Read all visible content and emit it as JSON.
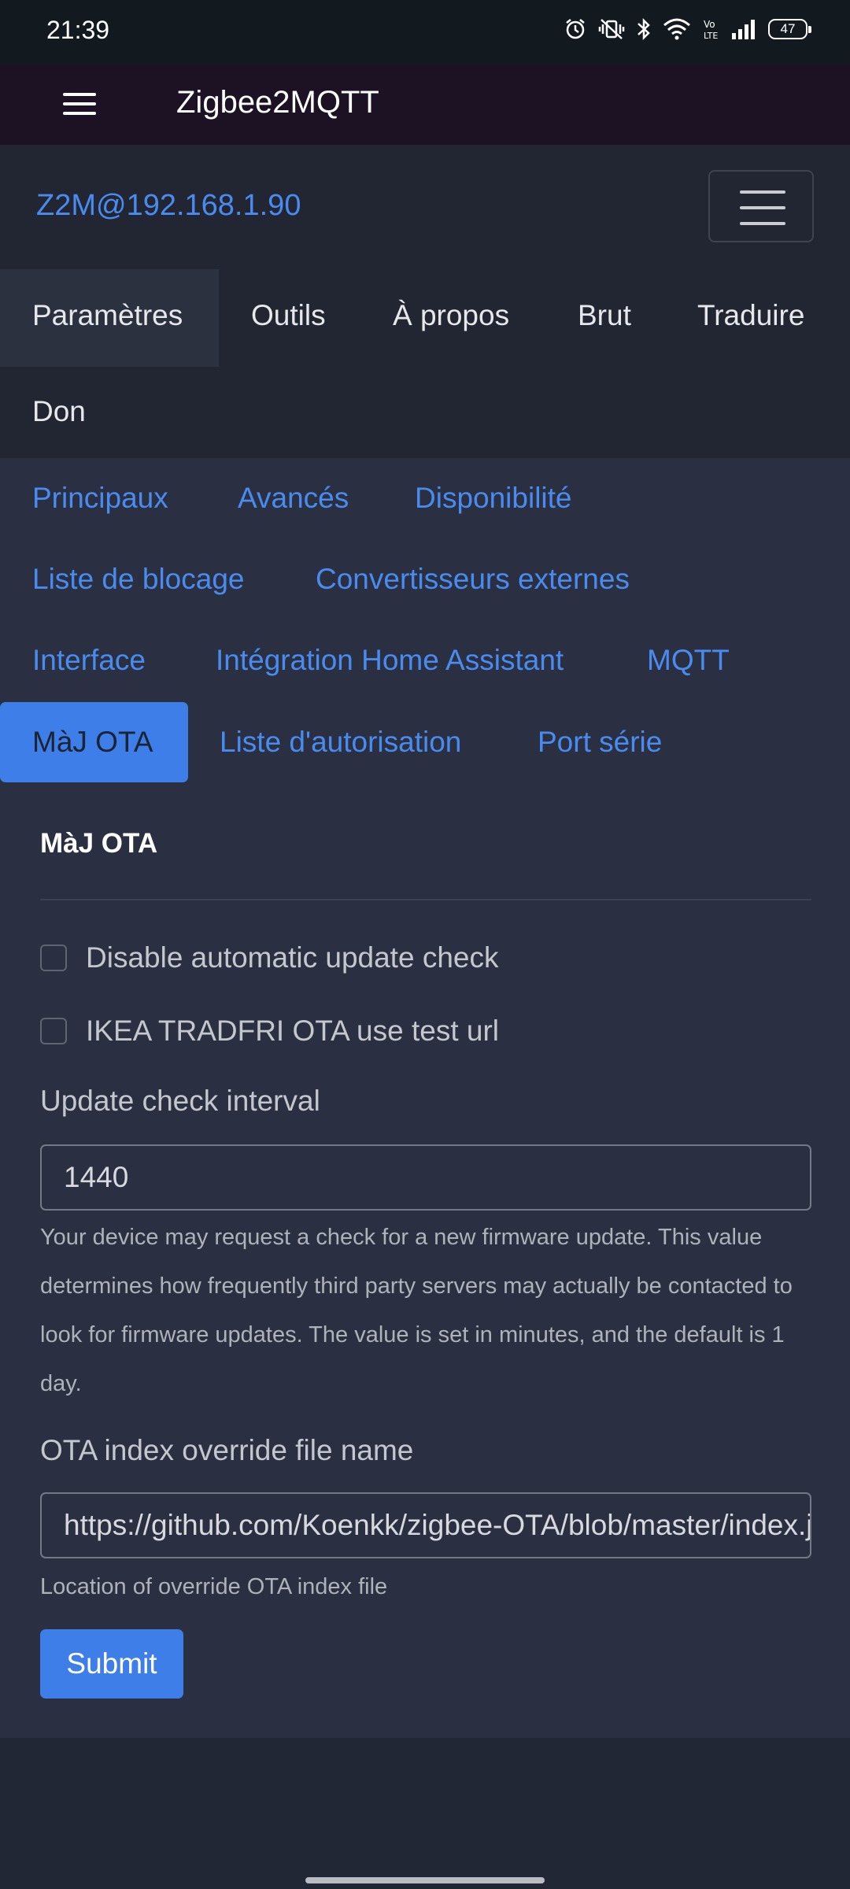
{
  "status_bar": {
    "time": "21:39",
    "battery": "47",
    "icons": [
      "alarm-icon",
      "vibrate-icon",
      "bluetooth-icon",
      "wifi-icon",
      "volte-icon",
      "signal-icon",
      "battery-icon"
    ]
  },
  "app_bar": {
    "title": "Zigbee2MQTT",
    "menu_icon": "hamburger-icon"
  },
  "top_nav": {
    "brand": "Z2M@192.168.1.90",
    "tabs": [
      "Paramètres",
      "Outils",
      "À propos",
      "Brut",
      "Traduire",
      "Don"
    ],
    "active_tab": "Paramètres"
  },
  "settings_tabs": {
    "items": [
      "Principaux",
      "Avancés",
      "Disponibilité",
      "Liste de blocage",
      "Convertisseurs externes",
      "Interface",
      "Intégration Home Assistant",
      "MQTT",
      "MàJ OTA",
      "Liste d'autorisation",
      "Port série"
    ],
    "active": "MàJ OTA"
  },
  "form": {
    "title": "MàJ OTA",
    "checkboxes": [
      {
        "label": "Disable automatic update check",
        "checked": false
      },
      {
        "label": "IKEA TRADFRI OTA use test url",
        "checked": false
      }
    ],
    "update_interval": {
      "label": "Update check interval",
      "value": "1440",
      "help": "Your device may request a check for a new firmware update. This value determines how frequently third party servers may actually be contacted to look for firmware updates. The value is set in minutes, and the default is 1 day."
    },
    "ota_index": {
      "label": "OTA index override file name",
      "value": "https://github.com/Koenkk/zigbee-OTA/blob/master/index.json",
      "help": "Location of override OTA index file"
    },
    "submit_label": "Submit"
  },
  "colors": {
    "accent": "#3d7ee8",
    "link": "#4a8bef",
    "app_bar": "#1d1124",
    "background": "#222735",
    "card": "#2a3041"
  }
}
